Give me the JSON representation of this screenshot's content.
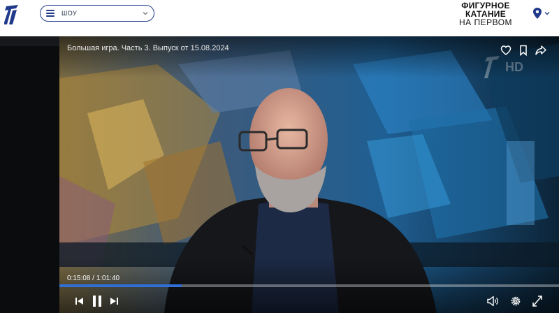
{
  "header": {
    "nav_select_label": "ШОУ",
    "promo": {
      "line1": "ФИГУРНОЕ",
      "line2": "КАТАНИЕ",
      "line3": "НА ПЕРВОМ"
    }
  },
  "player": {
    "title": "Большая игра. Часть 3. Выпуск от 15.08.2024",
    "time_current": "0:15:08",
    "time_separator": "/",
    "time_total": "1:01:40",
    "progress": 0.245,
    "watermark": "HD"
  },
  "colors": {
    "brand_blue": "#1f3a8a",
    "progress_blue": "#2f6fd6"
  },
  "icons": [
    "channel-one-logo",
    "menu-icon",
    "chevron-down-icon",
    "location-pin-icon",
    "heart-icon",
    "bookmark-icon",
    "share-icon",
    "previous-icon",
    "pause-icon",
    "next-icon",
    "volume-icon",
    "settings-icon",
    "fullscreen-icon"
  ]
}
